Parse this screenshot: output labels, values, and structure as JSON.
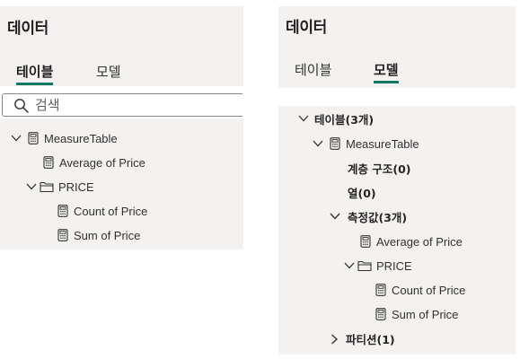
{
  "left": {
    "title": "데이터",
    "tabs": [
      {
        "label": "테이블",
        "active": true
      },
      {
        "label": "모델",
        "active": false
      }
    ],
    "search": {
      "placeholder": "검색"
    },
    "tree": {
      "table": "MeasureTable",
      "measure": "Average of Price",
      "folder": "PRICE",
      "folder_items": [
        "Count of Price",
        "Sum of Price"
      ]
    }
  },
  "right": {
    "title": "데이터",
    "tabs": [
      {
        "label": "테이블",
        "active": false
      },
      {
        "label": "모델",
        "active": true
      }
    ],
    "tree": {
      "tables_node": "테이블(3개)",
      "table": "MeasureTable",
      "hierarchies": "계층 구조(0)",
      "columns": "열(0)",
      "measures_node": "측정값(3개)",
      "measure": "Average of Price",
      "folder": "PRICE",
      "folder_items": [
        "Count of Price",
        "Sum of Price"
      ],
      "partitions": "파티션(1)"
    }
  },
  "colors": {
    "accent": "#117865",
    "panel_bg": "#f3f2f1",
    "text": "#252423"
  }
}
